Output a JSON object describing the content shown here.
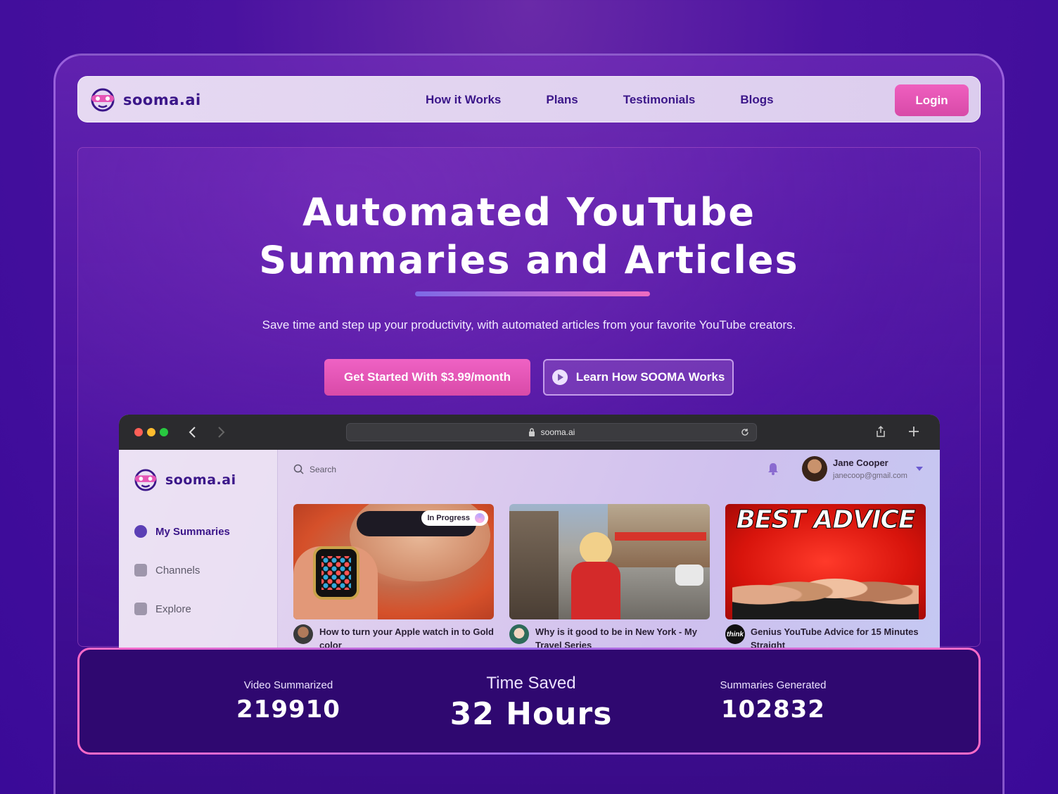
{
  "brand": {
    "name": "sooma.ai"
  },
  "nav": {
    "links": [
      "How it Works",
      "Plans",
      "Testimonials",
      "Blogs"
    ],
    "login_label": "Login"
  },
  "hero": {
    "title_line1": "Automated YouTube",
    "title_line2": "Summaries and Articles",
    "subtitle": "Save time and step up your productivity, with automated articles from your favorite YouTube creators.",
    "cta_primary": "Get Started With $3.99/month",
    "cta_secondary": "Learn How SOOMA Works"
  },
  "browser": {
    "url": "sooma.ai",
    "app": {
      "brand": "sooma.ai",
      "search_placeholder": "Search",
      "user": {
        "name": "Jane Cooper",
        "email": "janecoop@gmail.com"
      },
      "sidebar": [
        "My Summaries",
        "Channels",
        "Explore"
      ],
      "cards": [
        {
          "title": "How to turn your Apple watch in to Gold color",
          "badge": "In Progress"
        },
        {
          "title": "Why is it good to be in New York - My Travel Series",
          "badge": ""
        },
        {
          "title": "Genius YouTube Advice for 15 Minutes Straight",
          "badge": "",
          "thumb_text": "BEST ADVICE",
          "avatar_text": "think"
        }
      ]
    }
  },
  "stats": [
    {
      "label": "Video Summarized",
      "value": "219910"
    },
    {
      "label": "Time Saved",
      "value": "32 Hours"
    },
    {
      "label": "Summaries Generated",
      "value": "102832"
    }
  ],
  "colors": {
    "accent": "#e656b6",
    "brand": "#3b1689",
    "background": "#4a12a0"
  }
}
